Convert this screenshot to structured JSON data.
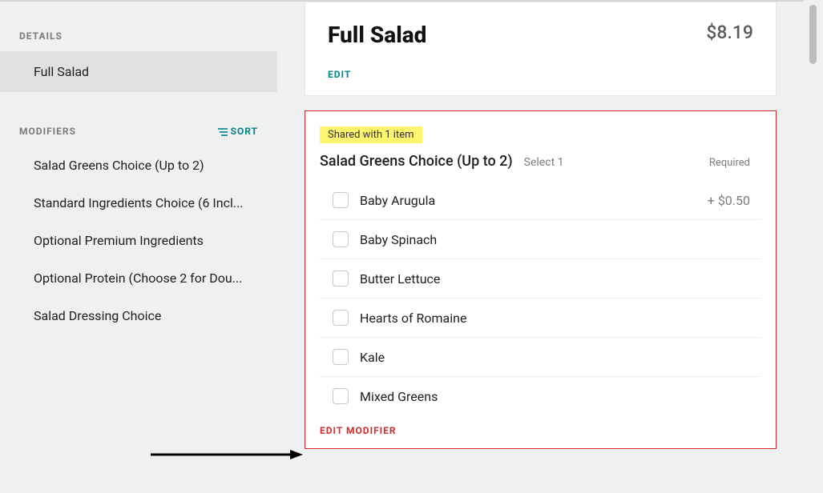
{
  "sidebar": {
    "details_header": "DETAILS",
    "details_item": "Full Salad",
    "modifiers_header": "MODIFIERS",
    "sort_label": "SORT",
    "modifiers": [
      "Salad Greens Choice (Up to 2)",
      "Standard Ingredients Choice (6 Incl...",
      "Optional Premium Ingredients",
      "Optional Protein (Choose 2 for Dou...",
      "Salad Dressing Choice"
    ]
  },
  "item": {
    "title": "Full Salad",
    "price": "$8.19",
    "edit_label": "EDIT"
  },
  "modifier_set": {
    "shared_badge": "Shared with 1 item",
    "title": "Salad Greens Choice (Up to 2)",
    "select_text": "Select 1",
    "required_text": "Required",
    "options": [
      {
        "label": "Baby Arugula",
        "price": "+ $0.50"
      },
      {
        "label": "Baby Spinach",
        "price": ""
      },
      {
        "label": "Butter Lettuce",
        "price": ""
      },
      {
        "label": "Hearts of Romaine",
        "price": ""
      },
      {
        "label": "Kale",
        "price": ""
      },
      {
        "label": "Mixed Greens",
        "price": ""
      }
    ],
    "edit_modifier_label": "EDIT MODIFIER"
  }
}
